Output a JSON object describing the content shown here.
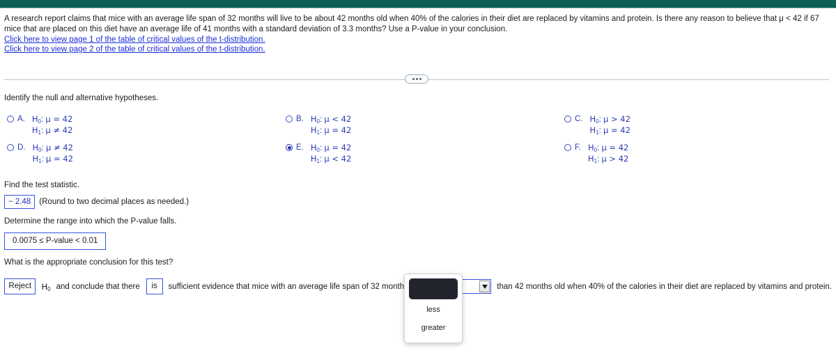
{
  "topbar": {
    "color": "#0a6055"
  },
  "problem": {
    "statement": "A research report claims that mice with an average life span of 32 months will live to be about 42 months old when 40% of the calories in their diet are replaced by vitamins and protein. Is there any reason to believe that μ < 42 if 67 mice that are placed on this diet have an average life of 41 months with a standard deviation of 3.3 months? Use a P-value in your conclusion.",
    "link1": "Click here to view page 1 of the table of critical values of the t-distribution.",
    "link2": "Click here to view page 2 of the table of critical values of the t-distribution."
  },
  "divider": {
    "dots_label": "more-options"
  },
  "questions": {
    "hypotheses_prompt": "Identify the null and alternative hypotheses.",
    "test_statistic_prompt": "Find the test statistic.",
    "pvalue_prompt": "Determine the range into which the P-value falls.",
    "conclusion_prompt": "What is the appropriate conclusion for this test?"
  },
  "options": [
    {
      "letter": "A.",
      "h0": "μ = 42",
      "h1": "μ ≠ 42",
      "selected": false
    },
    {
      "letter": "B.",
      "h0": "μ < 42",
      "h1": "μ = 42",
      "selected": false
    },
    {
      "letter": "C.",
      "h0": "μ > 42",
      "h1": "μ = 42",
      "selected": false
    },
    {
      "letter": "D.",
      "h0": "μ ≠ 42",
      "h1": "μ = 42",
      "selected": false
    },
    {
      "letter": "E.",
      "h0": "μ = 42",
      "h1": "μ < 42",
      "selected": true
    },
    {
      "letter": "F.",
      "h0": "μ = 42",
      "h1": "μ > 42",
      "selected": false
    }
  ],
  "hypothesis_labels": {
    "h0": "H",
    "h0_sub": "0",
    "h1": "H",
    "h1_sub": "1",
    "colon": ":"
  },
  "test_statistic": {
    "value": "− 2.48",
    "hint": "(Round to two decimal places as needed.)"
  },
  "pvalue": {
    "value": "0.0075 ≤ P-value < 0.01"
  },
  "conclusion": {
    "reject_value": "Reject",
    "h_label": "H",
    "h_sub": "0",
    "text_after_h": "and conclude that there",
    "is_value": "is",
    "text_middle": "sufficient evidence that mice with an average life span of 32 months will live to be",
    "combo_value": "",
    "text_end": "than 42 months old when 40% of the calories in their diet are replaced by vitamins and protein."
  },
  "dropdown": {
    "open": true,
    "items": [
      {
        "label": "",
        "highlighted": true
      },
      {
        "label": "less",
        "highlighted": false
      },
      {
        "label": "greater",
        "highlighted": false
      }
    ]
  }
}
